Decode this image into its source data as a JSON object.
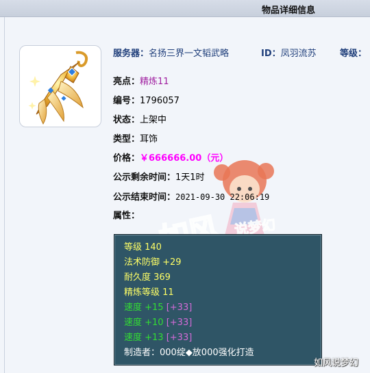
{
  "header": {
    "title": "物品详细信息"
  },
  "info": {
    "server_label": "服务器：",
    "server_value": "名扬三界一文韬武略",
    "id_label": "ID：",
    "id_value": "凤羽流苏",
    "level_label": "等级：",
    "highlight_label": "亮点：",
    "highlight_value": "精炼11",
    "serial_label": "编号：",
    "serial_value": "1796057",
    "status_label": "状态：",
    "status_value": "上架中",
    "type_label": "类型：",
    "type_value": "耳饰",
    "price_label": "价格：",
    "price_value": "￥666666.00（元）",
    "remaining_label": "公示剩余时间：",
    "remaining_value": "1天1时",
    "end_label": "公示结束时间：",
    "end_value": "2021-09-30 22:06:19",
    "attr_label": "属性："
  },
  "attributes": {
    "line1": "等级 140",
    "line2": "法术防御 +29",
    "line3": "耐久度 369",
    "line4": "精炼等级 11",
    "speed1_value": "速度 +15",
    "speed1_bonus": "[+33]",
    "speed2_value": "速度 +10",
    "speed2_bonus": "[+33]",
    "speed3_value": "速度 +13",
    "speed3_bonus": "[+33]",
    "maker": "制造者：000绽◆放000强化打造"
  },
  "watermark": {
    "main": "如风",
    "sub": "说梦幻",
    "corner": "如风说梦幻"
  },
  "colors": {
    "attr_bg": "#2f5566",
    "attr_yellow": "#ffff66",
    "attr_green": "#33dd33",
    "attr_purple": "#d46bd8",
    "price": "#ff00ff",
    "server_text": "#1f3e7a"
  },
  "icons": {
    "item": "earring-item-icon"
  }
}
